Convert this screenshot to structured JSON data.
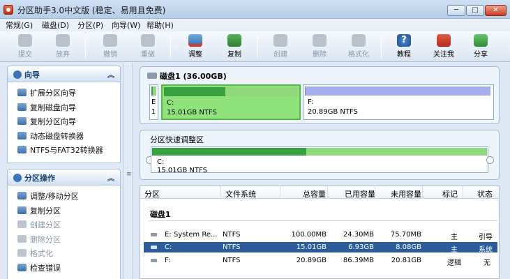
{
  "window": {
    "title": "分区助手3.0中文版 (稳定、易用且免费)",
    "min_glyph": "─",
    "max_glyph": "□",
    "close_glyph": "✕"
  },
  "menu": [
    "常规(G)",
    "磁盘(D)",
    "分区(P)",
    "向导(W)",
    "帮助(H)"
  ],
  "toolbar": {
    "submit": "提交",
    "discard": "放弃",
    "undo": "撤销",
    "redo": "重做",
    "resize": "调整",
    "copy": "复制",
    "create": "创建",
    "delete": "删除",
    "format": "格式化",
    "tutorial": "教程",
    "follow": "关注我",
    "share": "分享"
  },
  "wizard_section": {
    "title": "向导",
    "items": [
      "扩展分区向导",
      "复制磁盘向导",
      "复制分区向导",
      "动态磁盘转换器",
      "NTFS与FAT32转换器"
    ]
  },
  "partition_section": {
    "title": "分区操作",
    "items": [
      {
        "label": "调整/移动分区",
        "enabled": true
      },
      {
        "label": "复制分区",
        "enabled": true
      },
      {
        "label": "创建分区",
        "enabled": false
      },
      {
        "label": "删除分区",
        "enabled": false
      },
      {
        "label": "格式化",
        "enabled": false
      },
      {
        "label": "检查错误",
        "enabled": true
      }
    ]
  },
  "disk_map": {
    "title": "磁盘1 (36.00GB)",
    "parts": {
      "e": {
        "name": "E",
        "size": "1",
        "used_fraction": 0.24
      },
      "c": {
        "name": "C:",
        "size": "15.01GB NTFS",
        "used_fraction": 0.46
      },
      "f": {
        "name": "F:",
        "size": "20.89GB NTFS",
        "used_fraction": 0.003
      }
    }
  },
  "quick_adjust": {
    "title": "分区快速调整区",
    "part": {
      "name": "C:",
      "size": "15.01GB NTFS",
      "used_fraction": 0.46
    }
  },
  "table": {
    "headers": [
      "分区",
      "文件系统",
      "总容量",
      "已用容量",
      "未用容量",
      "标记",
      "状态"
    ],
    "group": "磁盘1",
    "rows": [
      {
        "partition": "E:  System Re...",
        "fs": "NTFS",
        "total": "100.00MB",
        "used": "24.30MB",
        "free": "75.70MB",
        "flag": "主",
        "status": "引导",
        "selected": false
      },
      {
        "partition": "C:",
        "fs": "NTFS",
        "total": "15.01GB",
        "used": "6.93GB",
        "free": "8.08GB",
        "flag": "主",
        "status": "系统",
        "selected": true
      },
      {
        "partition": "F:",
        "fs": "NTFS",
        "total": "20.89GB",
        "used": "86.39MB",
        "free": "20.81GB",
        "flag": "逻辑",
        "status": "无",
        "selected": false
      }
    ]
  },
  "colors": {
    "selected_row": "#2d5c9a",
    "used_bar": "#37a040",
    "free_bar": "#8fd87c",
    "logical_bar": "#a6aeed"
  }
}
